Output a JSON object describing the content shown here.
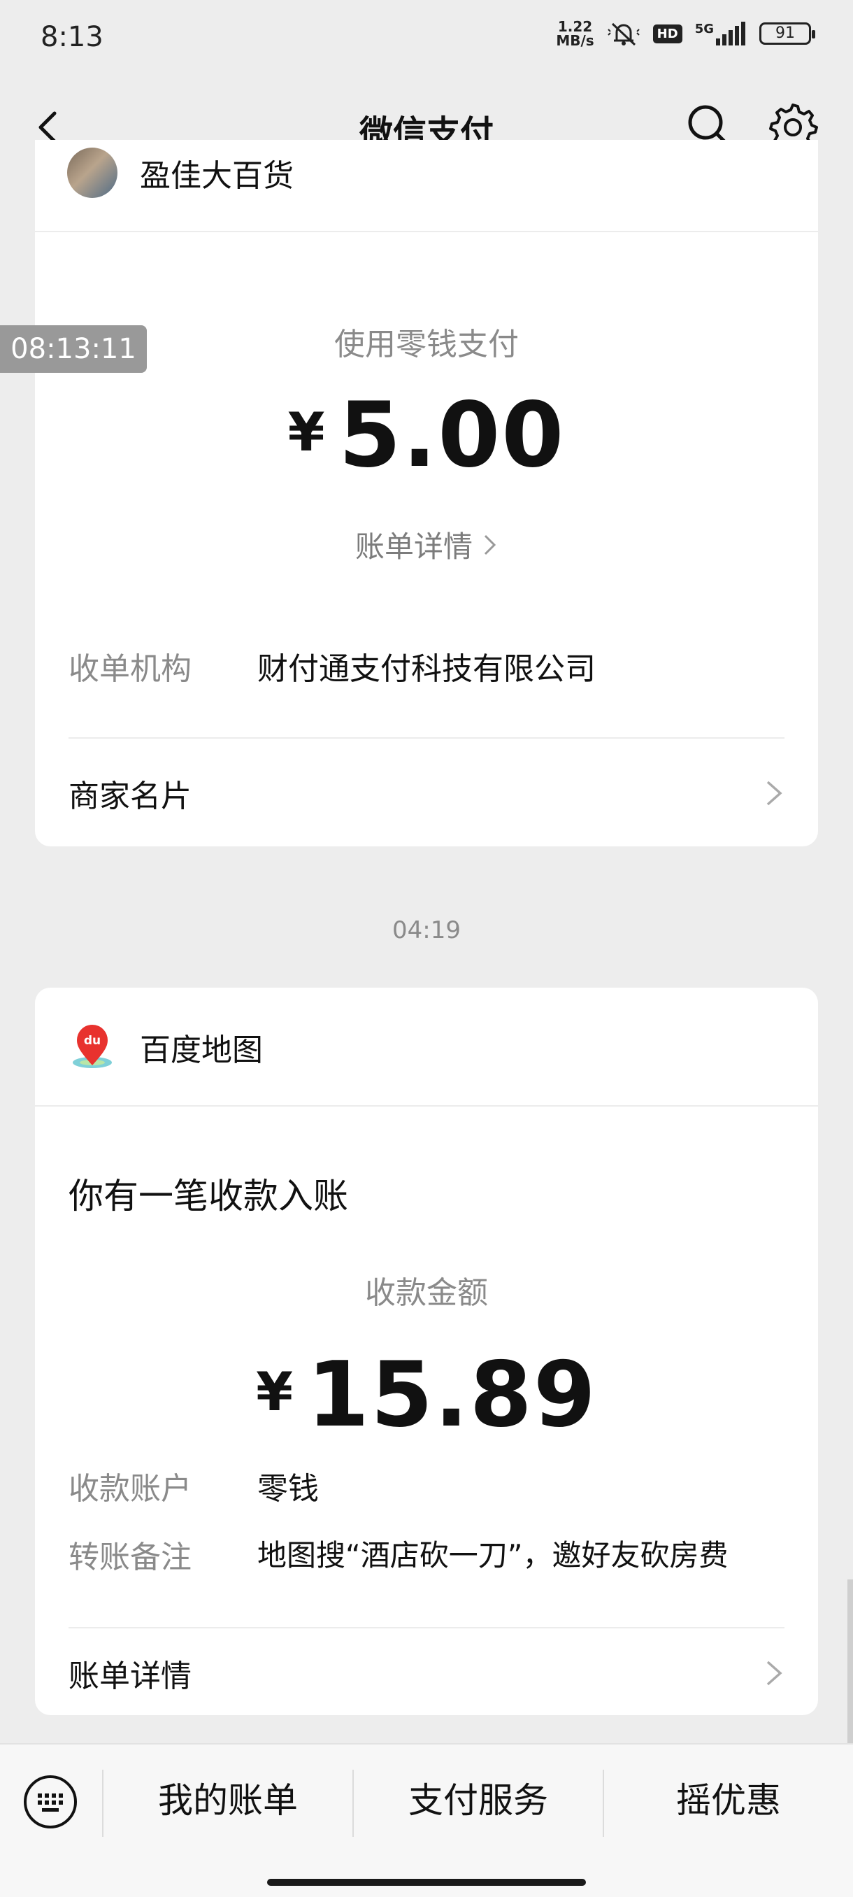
{
  "status_bar": {
    "time": "8:13",
    "net_speed_value": "1.22",
    "net_speed_unit": "MB/s",
    "hd": "HD",
    "network": "5G",
    "battery": "91"
  },
  "nav": {
    "title": "微信支付",
    "icons": [
      "back-arrow-icon",
      "search-icon",
      "gear-icon"
    ]
  },
  "overlay_time": "08:13:11",
  "card1": {
    "merchant_name": "盈佳大百货",
    "pay_method": "使用零钱支付",
    "currency_symbol": "¥",
    "amount": "5.00",
    "bill_detail_link": "账单详情",
    "acquirer_label": "收单机构",
    "acquirer_value": "财付通支付科技有限公司",
    "merchant_card_label": "商家名片"
  },
  "separator_time": "04:19",
  "card2": {
    "app_name": "百度地图",
    "title": "你有一笔收款入账",
    "amount_label": "收款金额",
    "currency_symbol": "¥",
    "amount": "15.89",
    "account_label": "收款账户",
    "account_value": "零钱",
    "remark_label": "转账备注",
    "remark_value": "地图搜“酒店砍一刀”，邀好友砍房费",
    "bill_detail_label": "账单详情"
  },
  "bottom_bar": {
    "menu": [
      "我的账单",
      "支付服务",
      "摇优惠"
    ]
  },
  "colors": {
    "background": "#ededed",
    "card": "#ffffff",
    "secondary_text": "#8a8a8a",
    "baidu_pin": "#e8322e"
  }
}
